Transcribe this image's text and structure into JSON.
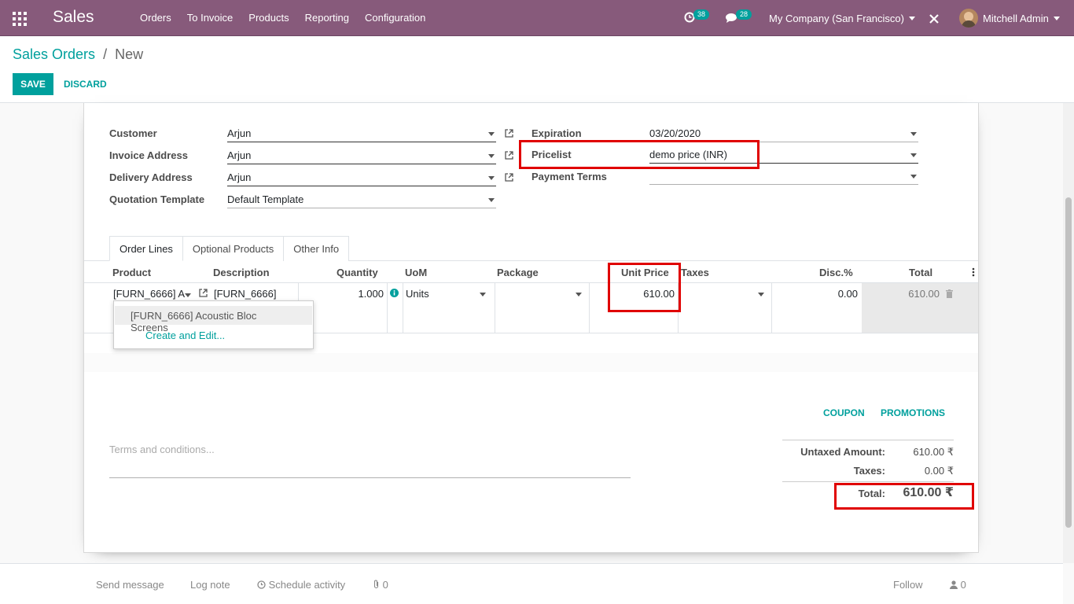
{
  "navbar": {
    "brand": "Sales",
    "menu": [
      "Orders",
      "To Invoice",
      "Products",
      "Reporting",
      "Configuration"
    ],
    "activity_count": "38",
    "message_count": "28",
    "company": "My Company (San Francisco)",
    "user": "Mitchell Admin"
  },
  "breadcrumb": {
    "parent": "Sales Orders",
    "separator": "/",
    "current": "New"
  },
  "buttons": {
    "save": "SAVE",
    "discard": "DISCARD"
  },
  "form": {
    "customer_label": "Customer",
    "customer": "Arjun",
    "invoice_label": "Invoice Address",
    "invoice": "Arjun",
    "delivery_label": "Delivery Address",
    "delivery": "Arjun",
    "template_label": "Quotation Template",
    "template": "Default Template",
    "expiration_label": "Expiration",
    "expiration": "03/20/2020",
    "pricelist_label": "Pricelist",
    "pricelist": "demo price (INR)",
    "payment_label": "Payment Terms",
    "payment": ""
  },
  "tabs": [
    "Order Lines",
    "Optional Products",
    "Other Info"
  ],
  "columns": {
    "product": "Product",
    "description": "Description",
    "quantity": "Quantity",
    "uom": "UoM",
    "package": "Package",
    "unit_price": "Unit Price",
    "taxes": "Taxes",
    "disc": "Disc.%",
    "total": "Total"
  },
  "line": {
    "product": "[FURN_6666] A",
    "description": "[FURN_6666]",
    "quantity": "1.000",
    "uom": "Units",
    "unit_price": "610.00",
    "disc": "0.00",
    "total": "610.00"
  },
  "autocomplete": {
    "option": "[FURN_6666] Acoustic Bloc Screens",
    "create": "Create and Edit..."
  },
  "actions": {
    "coupon": "COUPON",
    "promotions": "PROMOTIONS"
  },
  "terms_placeholder": "Terms and conditions...",
  "totals": {
    "untaxed_label": "Untaxed Amount:",
    "untaxed": "610.00 ₹",
    "taxes_label": "Taxes:",
    "taxes": "0.00 ₹",
    "total_label": "Total:",
    "total": "610.00 ₹"
  },
  "chatter": {
    "send": "Send message",
    "log": "Log note",
    "schedule": "Schedule activity",
    "attachments": "0",
    "follow": "Follow",
    "followers": "0"
  },
  "colors": {
    "brand": "#875a7b",
    "accent": "#00a09d",
    "highlight": "#e00000"
  }
}
